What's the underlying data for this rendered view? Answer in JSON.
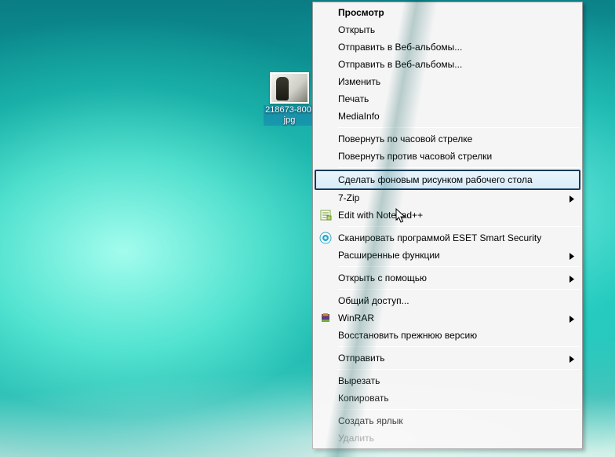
{
  "desktop": {
    "file": {
      "name": "218673-800.jpg"
    }
  },
  "menu": {
    "view": "Просмотр",
    "open": "Открыть",
    "send_web1": "Отправить в Веб-альбомы...",
    "send_web2": "Отправить в Веб-альбомы...",
    "edit": "Изменить",
    "print": "Печать",
    "mediainfo": "MediaInfo",
    "rotate_cw": "Повернуть по часовой стрелке",
    "rotate_ccw": "Повернуть против часовой стрелки",
    "set_wallpaper": "Сделать фоновым рисунком рабочего стола",
    "seven_zip": "7-Zip",
    "edit_npp": "Edit with Notepad++",
    "eset_scan": "Сканировать программой ESET Smart Security",
    "eset_advanced": "Расширенные функции",
    "open_with": "Открыть с помощью",
    "sharing": "Общий доступ...",
    "winrar": "WinRAR",
    "restore_prev": "Восстановить прежнюю версию",
    "send_to": "Отправить",
    "cut": "Вырезать",
    "copy": "Копировать",
    "create_shortcut": "Создать ярлык",
    "delete": "Удалить"
  }
}
